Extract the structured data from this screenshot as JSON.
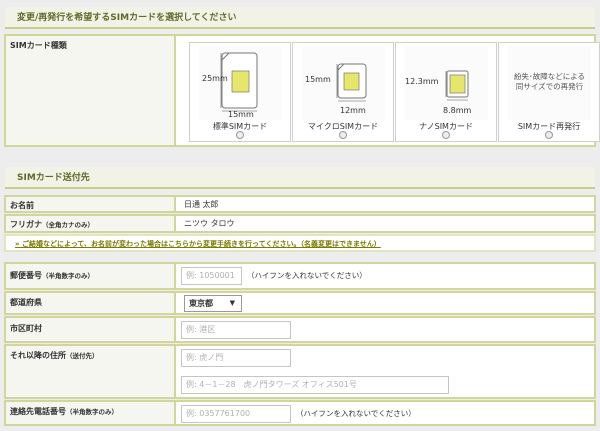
{
  "section1": {
    "title": "変更/再発行を希望するSIMカードを選択してください"
  },
  "sim": {
    "label": "SIMカード種類",
    "options": [
      {
        "name": "標準SIMカード",
        "height_label": "25mm",
        "width_label": "15mm"
      },
      {
        "name": "マイクロSIMカード",
        "height_label": "15mm",
        "width_label": "12mm"
      },
      {
        "name": "ナノSIMカード",
        "height_label": "12.3mm",
        "width_label": "8.8mm"
      },
      {
        "name": "SIMカード再発行",
        "description": "紛失･故障などによる同サイズでの再発行"
      }
    ]
  },
  "section2": {
    "title": "SIMカード送付先"
  },
  "name_row": {
    "label": "お名前",
    "value": "日通 太郎"
  },
  "kana_row": {
    "label": "フリガナ",
    "label_note": "（全角カナのみ）",
    "value": "ニツウ タロウ"
  },
  "notice_link": "» ご結婚などによって、お名前が変わった場合はこちらから変更手続きを行ってください。（名義変更はできません）",
  "postal": {
    "label": "郵便番号",
    "label_note": "（半角数字のみ）",
    "placeholder": "例: 1050001",
    "hint": "（ハイフンを入れないでください）"
  },
  "prefecture": {
    "label": "都道府県",
    "selected": "東京都"
  },
  "city": {
    "label": "市区町村",
    "placeholder": "例: 港区"
  },
  "address": {
    "label": "それ以降の住所",
    "label_note": "（送付先）",
    "placeholder1": "例: 虎ノ門",
    "placeholder2": "例: 4－1－28　虎ノ門タワーズ オフィス501号"
  },
  "phone": {
    "label": "連絡先電話番号",
    "label_note": "（半角数字のみ）",
    "placeholder": "例: 0357761700",
    "hint": "（ハイフンを入れないでください）"
  },
  "colors": {
    "border": "#d3d69a",
    "title_text": "#5f6b2a",
    "sim_chip": "#e6e66a"
  }
}
